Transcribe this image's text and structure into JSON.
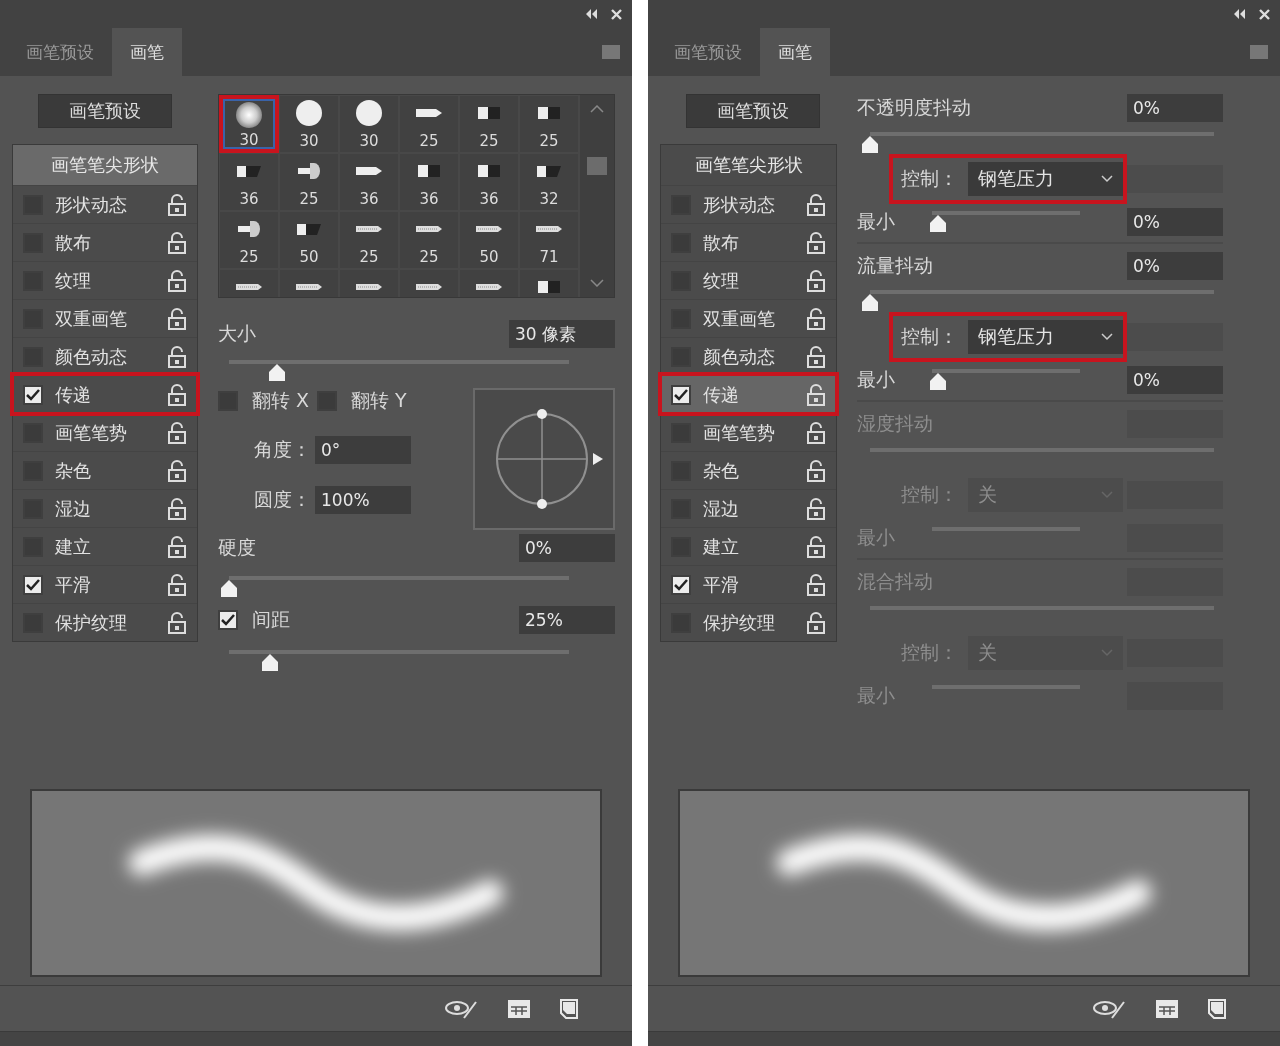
{
  "panels": [
    {
      "kind": "brush_tip_shape",
      "tabs": [
        {
          "label": "画笔预设",
          "selected": false
        },
        {
          "label": "画笔",
          "selected": true
        }
      ],
      "preset_button": "画笔预设",
      "sidebar": {
        "header": {
          "label": "画笔笔尖形状",
          "selected": true
        },
        "items": [
          {
            "label": "形状动态",
            "checked": false,
            "selected": false,
            "highlighted": false
          },
          {
            "label": "散布",
            "checked": false,
            "selected": false,
            "highlighted": false
          },
          {
            "label": "纹理",
            "checked": false,
            "selected": false,
            "highlighted": false
          },
          {
            "label": "双重画笔",
            "checked": false,
            "selected": false,
            "highlighted": false
          },
          {
            "label": "颜色动态",
            "checked": false,
            "selected": false,
            "highlighted": false
          },
          {
            "label": "传递",
            "checked": true,
            "selected": false,
            "highlighted": true
          },
          {
            "label": "画笔笔势",
            "checked": false,
            "selected": false,
            "highlighted": false
          },
          {
            "label": "杂色",
            "checked": false,
            "selected": false,
            "highlighted": false
          },
          {
            "label": "湿边",
            "checked": false,
            "selected": false,
            "highlighted": false
          },
          {
            "label": "建立",
            "checked": false,
            "selected": false,
            "highlighted": false
          },
          {
            "label": "平滑",
            "checked": true,
            "selected": false,
            "highlighted": false
          },
          {
            "label": "保护纹理",
            "checked": false,
            "selected": false,
            "highlighted": false
          }
        ]
      },
      "tips": [
        {
          "kind": "soft",
          "size": "30",
          "selected": true
        },
        {
          "kind": "hard",
          "size": "30",
          "selected": false
        },
        {
          "kind": "hard",
          "size": "30",
          "selected": false
        },
        {
          "kind": "bullet",
          "size": "25",
          "selected": false
        },
        {
          "kind": "block",
          "size": "25",
          "selected": false
        },
        {
          "kind": "block",
          "size": "25",
          "selected": false
        },
        {
          "kind": "wedge",
          "size": "36",
          "selected": false
        },
        {
          "kind": "knob",
          "size": "25",
          "selected": false
        },
        {
          "kind": "bullet",
          "size": "36",
          "selected": false
        },
        {
          "kind": "block",
          "size": "36",
          "selected": false
        },
        {
          "kind": "block",
          "size": "36",
          "selected": false
        },
        {
          "kind": "wedge",
          "size": "32",
          "selected": false
        },
        {
          "kind": "knob",
          "size": "25",
          "selected": false
        },
        {
          "kind": "wedge",
          "size": "50",
          "selected": false
        },
        {
          "kind": "bristle",
          "size": "25",
          "selected": false
        },
        {
          "kind": "bristle",
          "size": "25",
          "selected": false
        },
        {
          "kind": "bristle",
          "size": "50",
          "selected": false
        },
        {
          "kind": "bristle",
          "size": "71",
          "selected": false
        },
        {
          "kind": "bristle",
          "selected": false
        },
        {
          "kind": "bristle",
          "selected": false
        },
        {
          "kind": "bristle",
          "selected": false
        },
        {
          "kind": "bristle",
          "selected": false
        },
        {
          "kind": "bristle",
          "selected": false
        },
        {
          "kind": "block",
          "selected": false
        }
      ],
      "size": {
        "label": "大小",
        "value": "30 像素",
        "level": 0.14
      },
      "flip": [
        {
          "label": "翻转 X",
          "checked": false
        },
        {
          "label": "翻转 Y",
          "checked": false
        }
      ],
      "angle": {
        "label": "角度：",
        "value": "0°"
      },
      "roundness": {
        "label": "圆度：",
        "value": "100%"
      },
      "hardness": {
        "label": "硬度",
        "value": "0%",
        "level": 0
      },
      "spacing": {
        "label": "间距",
        "checked": true,
        "value": "25%",
        "level": 0.12
      }
    },
    {
      "kind": "transfer",
      "tabs": [
        {
          "label": "画笔预设",
          "selected": false
        },
        {
          "label": "画笔",
          "selected": true
        }
      ],
      "preset_button": "画笔预设",
      "sidebar": {
        "header": {
          "label": "画笔笔尖形状",
          "selected": false
        },
        "items": [
          {
            "label": "形状动态",
            "checked": false,
            "selected": false,
            "highlighted": false
          },
          {
            "label": "散布",
            "checked": false,
            "selected": false,
            "highlighted": false
          },
          {
            "label": "纹理",
            "checked": false,
            "selected": false,
            "highlighted": false
          },
          {
            "label": "双重画笔",
            "checked": false,
            "selected": false,
            "highlighted": false
          },
          {
            "label": "颜色动态",
            "checked": false,
            "selected": false,
            "highlighted": false
          },
          {
            "label": "传递",
            "checked": true,
            "selected": true,
            "highlighted": true
          },
          {
            "label": "画笔笔势",
            "checked": false,
            "selected": false,
            "highlighted": false
          },
          {
            "label": "杂色",
            "checked": false,
            "selected": false,
            "highlighted": false
          },
          {
            "label": "湿边",
            "checked": false,
            "selected": false,
            "highlighted": false
          },
          {
            "label": "建立",
            "checked": false,
            "selected": false,
            "highlighted": false
          },
          {
            "label": "平滑",
            "checked": true,
            "selected": false,
            "highlighted": false
          },
          {
            "label": "保护纹理",
            "checked": false,
            "selected": false,
            "highlighted": false
          }
        ]
      },
      "sections": [
        {
          "label": "不透明度抖动",
          "value": "0%",
          "level": 0,
          "disabled": false,
          "control": {
            "label": "控制：",
            "value": "钢笔压力",
            "highlighted": true
          },
          "minimum": {
            "label": "最小",
            "value": "0%",
            "level": 0.04
          }
        },
        {
          "label": "流量抖动",
          "value": "0%",
          "level": 0,
          "disabled": false,
          "control": {
            "label": "控制：",
            "value": "钢笔压力",
            "highlighted": true
          },
          "minimum": {
            "label": "最小",
            "value": "0%",
            "level": 0.04
          }
        },
        {
          "label": "湿度抖动",
          "disabled": true,
          "control": {
            "label": "控制：",
            "value": "关",
            "highlighted": false
          },
          "minimum": {
            "label": "最小"
          }
        },
        {
          "label": "混合抖动",
          "disabled": true,
          "control": {
            "label": "控制：",
            "value": "关",
            "highlighted": false
          },
          "minimum": {
            "label": "最小"
          }
        }
      ]
    }
  ]
}
